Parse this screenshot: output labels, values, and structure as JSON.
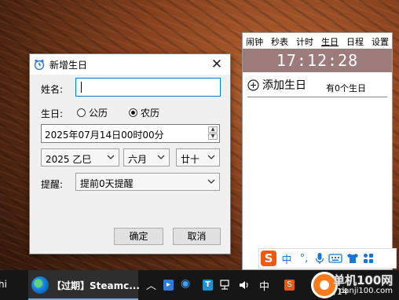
{
  "dialog": {
    "title": "新增生日",
    "close_glyph": "✕",
    "name_label": "姓名:",
    "name_value": "",
    "birthday_label": "生日:",
    "radio_solar": "公历",
    "radio_lunar": "农历",
    "selected_calendar": "农历",
    "datetime_value": "2025年07月14日00时00分",
    "year_select": "2025 乙巳",
    "month_select": "六月",
    "day_select": "廿十",
    "reminder_label": "提醒:",
    "reminder_select": "提前0天提醒",
    "ok_button": "确定",
    "cancel_button": "取消"
  },
  "widget": {
    "tabs": [
      "闹钟",
      "秒表",
      "计时",
      "生日",
      "日程",
      "设置"
    ],
    "active_tab": "生日",
    "clock": "17:12:28",
    "add_label": "添加生日",
    "count_text": "有0个生日"
  },
  "ime": {
    "logo": "S",
    "lang": "中",
    "punct": "°,",
    "icons": [
      "mic-icon",
      "keyboard-icon",
      "shirt-icon",
      "apps-icon"
    ]
  },
  "taskbar": {
    "left_fragment": "hi",
    "active_app": "【过期】Steamc...",
    "tray_ime": "中",
    "clock_partial": "7/14",
    "watermark_title": "单机100网",
    "watermark_sub": "danji100.com"
  },
  "colors": {
    "clock_bar": "#9c7b7b",
    "accent": "#0078d7",
    "ime_brand": "#f05a0c"
  }
}
